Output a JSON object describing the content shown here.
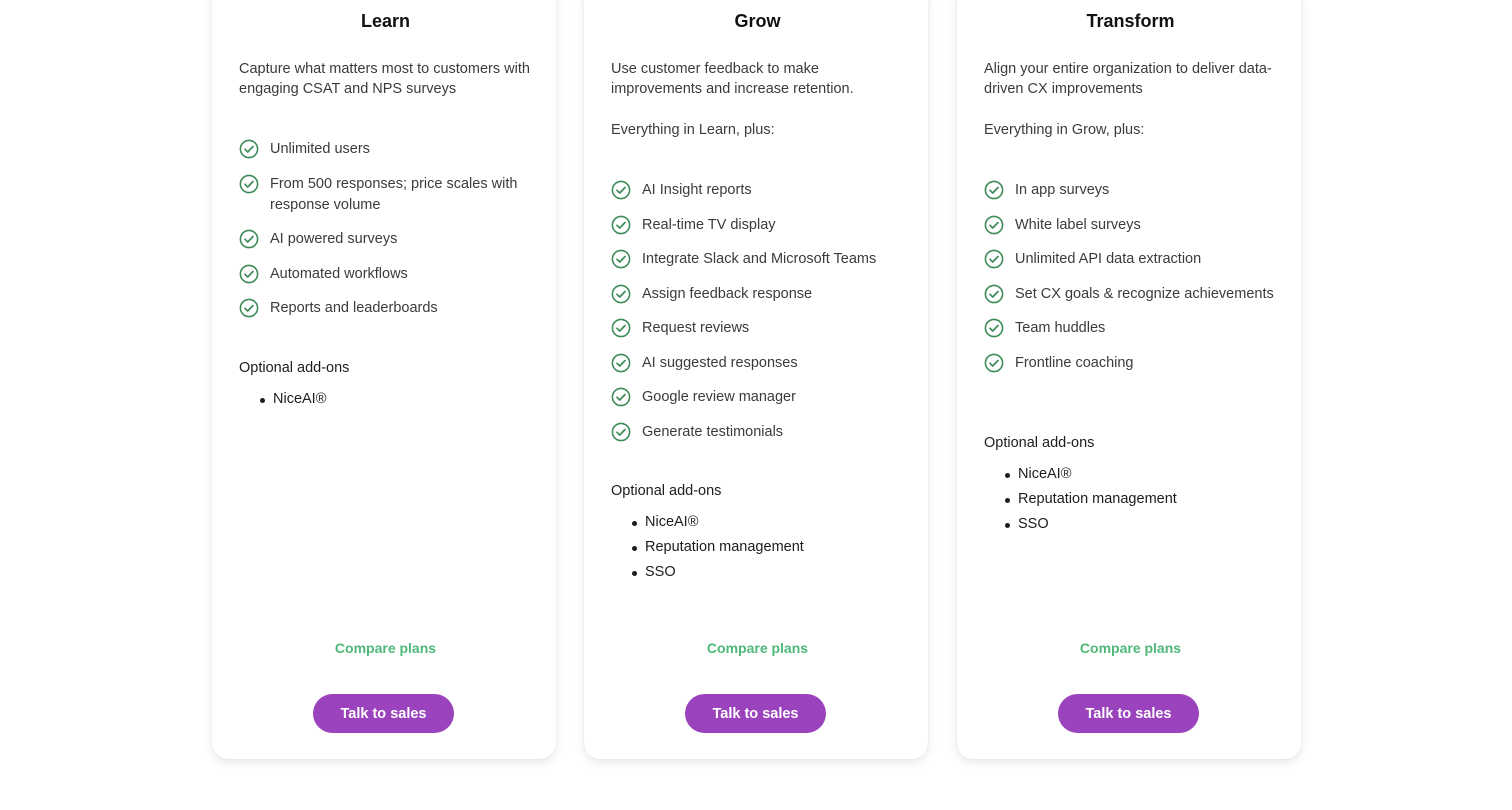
{
  "plans": [
    {
      "title": "Learn",
      "description": "Capture what matters most to customers with engaging CSAT and NPS surveys",
      "plus_text": "",
      "features": [
        "Unlimited users",
        "From 500 responses; price scales with response volume",
        "AI powered surveys",
        "Automated workflows",
        "Reports and leaderboards"
      ],
      "addons_title": "Optional add-ons",
      "addons": [
        "NiceAI®"
      ],
      "compare_label": "Compare plans",
      "cta_label": "Talk to sales"
    },
    {
      "title": "Grow",
      "description": "Use customer feedback to make improvements and increase retention.",
      "plus_text": "Everything in Learn, plus:",
      "features": [
        "AI Insight reports",
        "Real-time TV display",
        "Integrate Slack and Microsoft Teams",
        "Assign feedback response",
        "Request reviews",
        "AI suggested responses",
        "Google review manager",
        "Generate testimonials"
      ],
      "addons_title": "Optional add-ons",
      "addons": [
        "NiceAI®",
        "Reputation management",
        "SSO"
      ],
      "compare_label": "Compare plans",
      "cta_label": "Talk to sales"
    },
    {
      "title": "Transform",
      "description": "Align your entire organization to deliver data-driven CX improvements",
      "plus_text": "Everything in Grow, plus:",
      "features": [
        "In app surveys",
        "White label surveys",
        "Unlimited API data extraction",
        "Set CX goals & recognize achievements",
        "Team huddles",
        "Frontline coaching"
      ],
      "addons_title": "Optional add-ons",
      "addons": [
        "NiceAI®",
        "Reputation management",
        "SSO"
      ],
      "compare_label": "Compare plans",
      "cta_label": "Talk to sales"
    }
  ],
  "icons": {
    "feature": "check-circle-icon"
  },
  "colors": {
    "check": "#3d8b58",
    "compare_link": "#4fb879",
    "cta_bg": "#9b43bd"
  }
}
